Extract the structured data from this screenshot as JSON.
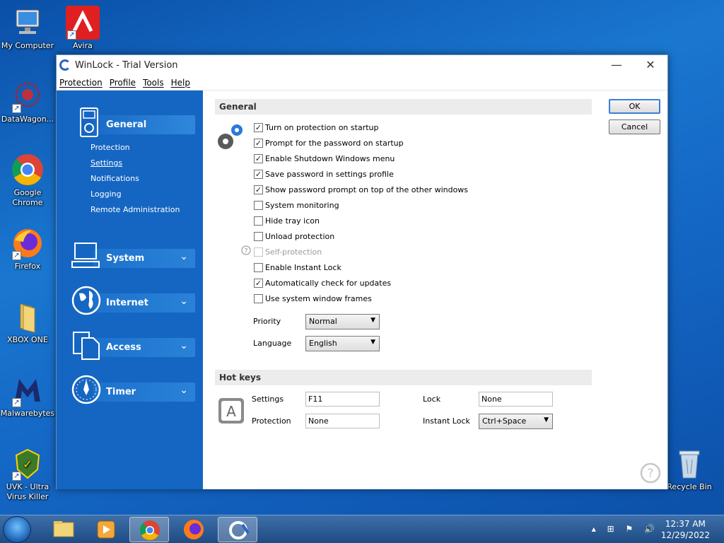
{
  "desktop": {
    "icons": [
      {
        "label": "My Computer"
      },
      {
        "label": "Avira"
      },
      {
        "label": "DataWagon..."
      },
      {
        "label": "Google Chrome"
      },
      {
        "label": "Firefox"
      },
      {
        "label": "XBOX ONE"
      },
      {
        "label": "Malwarebytes"
      },
      {
        "label": "UVK - Ultra Virus Killer"
      },
      {
        "label": "Recycle Bin"
      }
    ]
  },
  "window": {
    "title": "WinLock - Trial Version",
    "minimize": "—",
    "close": "✕",
    "menu": [
      "Protection",
      "Profile",
      "Tools",
      "Help"
    ]
  },
  "sidebar": {
    "general": {
      "label": "General",
      "items": [
        "Protection",
        "Settings",
        "Notifications",
        "Logging",
        "Remote Administration"
      ],
      "selected": "Settings"
    },
    "system": {
      "label": "System"
    },
    "internet": {
      "label": "Internet"
    },
    "access": {
      "label": "Access"
    },
    "timer": {
      "label": "Timer"
    }
  },
  "general": {
    "heading": "General",
    "options": [
      {
        "label": "Turn on protection on startup",
        "checked": true
      },
      {
        "label": "Prompt for the password on startup",
        "checked": true
      },
      {
        "label": "Enable Shutdown Windows menu",
        "checked": true
      },
      {
        "label": "Save password in settings profile",
        "checked": true
      },
      {
        "label": "Show password prompt on top of the other windows",
        "checked": true
      },
      {
        "label": "System monitoring",
        "checked": false
      },
      {
        "label": "Hide tray icon",
        "checked": false
      },
      {
        "label": "Unload protection",
        "checked": false
      },
      {
        "label": "Self-protection",
        "checked": false,
        "disabled": true
      },
      {
        "label": "Enable Instant Lock",
        "checked": false
      },
      {
        "label": "Automatically check for updates",
        "checked": true
      },
      {
        "label": "Use system window frames",
        "checked": false
      }
    ],
    "priority_label": "Priority",
    "priority_value": "Normal",
    "language_label": "Language",
    "language_value": "English"
  },
  "hotkeys": {
    "heading": "Hot keys",
    "settings_label": "Settings",
    "settings_value": "F11",
    "protection_label": "Protection",
    "protection_value": "None",
    "lock_label": "Lock",
    "lock_value": "None",
    "instant_lock_label": "Instant Lock",
    "instant_lock_value": "Ctrl+Space"
  },
  "buttons": {
    "ok": "OK",
    "cancel": "Cancel"
  },
  "taskbar": {
    "time": "12:37 AM",
    "date": "12/29/2022"
  },
  "colors": {
    "sidebar": "#1566c2",
    "accent": "#3c7fd4"
  }
}
